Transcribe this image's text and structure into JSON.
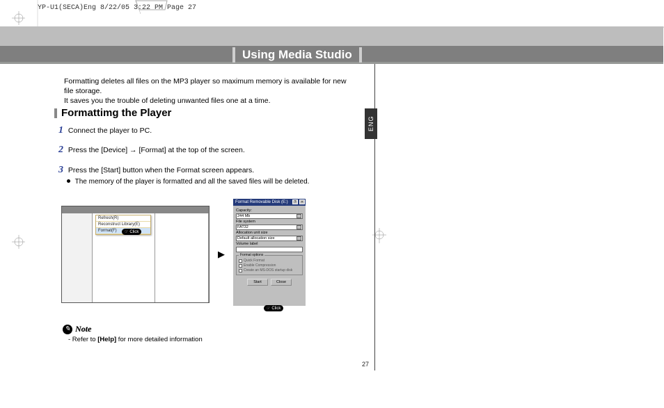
{
  "crop_header": "YP-U1(SECA)Eng  8/22/05 3:22 PM  Page 27",
  "ribbon_title": "Using Media Studio",
  "intro_line1": "Formatting deletes all files on the MP3 player so maximum memory is available for new file storage.",
  "intro_line2": "It saves you the trouble of deleting unwanted files one at a time.",
  "side_tab": "ENG",
  "section_heading": "Formattimg the Player",
  "steps": {
    "s1": {
      "num": "1",
      "text": "Connect the player to PC."
    },
    "s2": {
      "num": "2",
      "text": "Press the [Device] → [Format] at the top of the screen."
    },
    "s3": {
      "num": "3",
      "text": "Press the [Start] button when the Format screen appears.",
      "bullet": "The memory of the player is formatted and all the saved files will be deleted."
    }
  },
  "figure1": {
    "menu_items": {
      "a": "Refresh(R)",
      "b": "Reconstruct Library(E)",
      "c": "Format(F)"
    },
    "click_label": "Click"
  },
  "figure2": {
    "title": "Format Removable Disk (E:)",
    "capacity_label": "Capacity:",
    "capacity_value": "244 Mb",
    "fs_label": "File system",
    "fs_value": "FAT32",
    "alloc_label": "Allocation unit size",
    "alloc_value": "Default allocation size",
    "vol_label": "Volume label",
    "options_legend": "Format options",
    "opt1": "Quick Format",
    "opt2": "Enable Compression",
    "opt3": "Create an MS-DOS startup disk",
    "btn_start": "Start",
    "btn_close": "Close",
    "click_label": "Click"
  },
  "note": {
    "heading": "Note",
    "body_prefix": "- Refer to ",
    "body_bold": "[Help]",
    "body_suffix": " for more detailed information"
  },
  "page_number": "27"
}
